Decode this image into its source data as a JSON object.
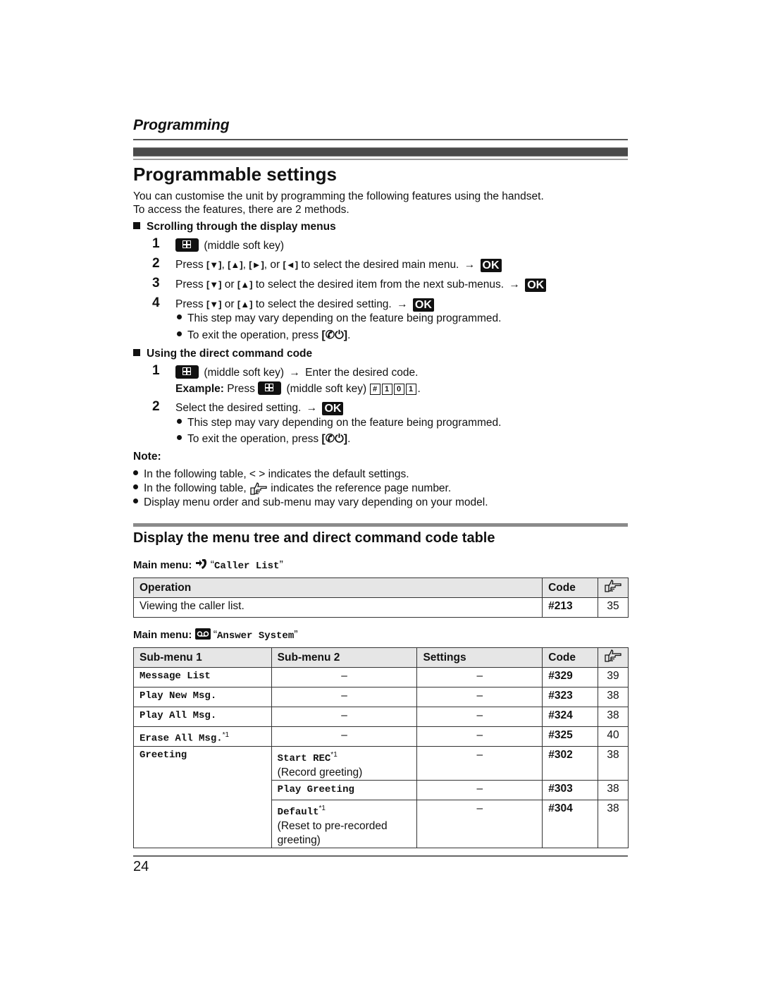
{
  "header": {
    "chapter": "Programming",
    "title": "Programmable settings"
  },
  "intro": {
    "line1": "You can customise the unit by programming the following features using the handset.",
    "line2": "To access the features, there are 2 methods."
  },
  "scrolling": {
    "heading": "Scrolling through the display menus",
    "steps": [
      {
        "num": "1",
        "text": "(middle soft key)"
      },
      {
        "num": "2",
        "press": "Press",
        "keys": [
          "[▼]",
          "[▲]",
          "[►]",
          "[◄]"
        ],
        "or": "or",
        "text": "to select the desired main menu.",
        "ok": "OK"
      },
      {
        "num": "3",
        "press": "Press",
        "keys": [
          "[▼]",
          "[▲]"
        ],
        "or": "or",
        "text": "to select the desired item from the next sub-menus.",
        "ok": "OK"
      },
      {
        "num": "4",
        "press": "Press",
        "keys": [
          "[▼]",
          "[▲]"
        ],
        "or": "or",
        "text": "to select the desired setting.",
        "ok": "OK"
      }
    ],
    "bullets": [
      "This step may vary depending on the feature being programmed.",
      "To exit the operation, press"
    ],
    "off_key": "[✆⏻]"
  },
  "direct": {
    "heading": "Using the direct command code",
    "step1_text": "(middle soft key)",
    "step1_text2": "Enter the desired code.",
    "example_label": "Example:",
    "example_press": "Press",
    "example_text": "(middle soft key)",
    "example_keys": [
      "#",
      "1",
      "0",
      "1"
    ],
    "step2_text": "Select the desired setting.",
    "ok": "OK",
    "bullets": [
      "This step may vary depending on the feature being programmed.",
      "To exit the operation, press"
    ],
    "off_key": "[✆⏻]"
  },
  "note": {
    "label": "Note:",
    "items": [
      "In the following table, < > indicates the default settings.",
      "In the following table,",
      "indicates the reference page number.",
      "Display menu order and sub-menu may vary depending on your model."
    ]
  },
  "table_section": {
    "title": "Display the menu tree and direct command code table"
  },
  "caller_list": {
    "main_menu_label": "Main menu:",
    "menu_name": "Caller List",
    "headers": {
      "operation": "Operation",
      "code": "Code"
    },
    "rows": [
      {
        "operation": "Viewing the caller list.",
        "code": "#213",
        "ref": "35"
      }
    ]
  },
  "answer_system": {
    "main_menu_label": "Main menu:",
    "menu_name": "Answer System",
    "headers": {
      "sub1": "Sub-menu 1",
      "sub2": "Sub-menu 2",
      "settings": "Settings",
      "code": "Code"
    },
    "rows": [
      {
        "sub1": "Message List",
        "sub1_note": "",
        "sub2": "–",
        "settings": "–",
        "code": "#329",
        "ref": "39"
      },
      {
        "sub1": "Play New Msg.",
        "sub1_note": "",
        "sub2": "–",
        "settings": "–",
        "code": "#323",
        "ref": "38"
      },
      {
        "sub1": "Play All Msg.",
        "sub1_note": "",
        "sub2": "–",
        "settings": "–",
        "code": "#324",
        "ref": "38"
      },
      {
        "sub1": "Erase All Msg.",
        "sub1_note": "*1",
        "sub2": "–",
        "settings": "–",
        "code": "#325",
        "ref": "40"
      }
    ],
    "greeting": {
      "sub1": "Greeting",
      "items": [
        {
          "sub2": "Start REC",
          "note": "*1",
          "desc": "(Record greeting)",
          "settings": "–",
          "code": "#302",
          "ref": "38"
        },
        {
          "sub2": "Play Greeting",
          "note": "",
          "desc": "",
          "settings": "–",
          "code": "#303",
          "ref": "38"
        },
        {
          "sub2": "Default",
          "note": "*1",
          "desc": "(Reset to pre-recorded greeting)",
          "settings": "–",
          "code": "#304",
          "ref": "38"
        }
      ]
    }
  },
  "footer": {
    "page_number": "24"
  }
}
